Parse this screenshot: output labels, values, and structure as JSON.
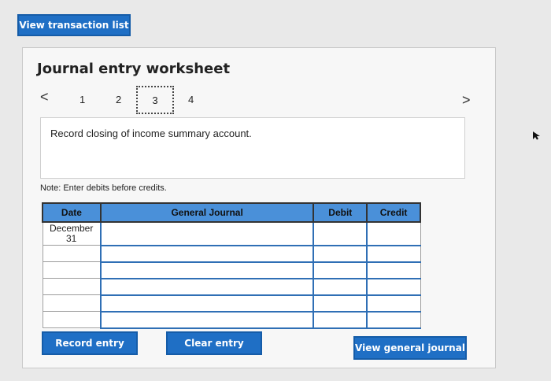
{
  "top_button": {
    "label": "View transaction list"
  },
  "worksheet": {
    "title": "Journal entry worksheet",
    "nav": {
      "prev_symbol": "<",
      "next_symbol": ">",
      "pages": [
        "1",
        "2",
        "3",
        "4"
      ],
      "active_page": "3"
    },
    "instruction": "Record closing of income summary account.",
    "note": "Note: Enter debits before credits."
  },
  "table": {
    "headers": {
      "date": "Date",
      "general_journal": "General Journal",
      "debit": "Debit",
      "credit": "Credit"
    },
    "first_row": {
      "date_month": "December",
      "date_day": "31"
    }
  },
  "buttons": {
    "record_entry": "Record entry",
    "clear_entry": "Clear entry",
    "view_general_journal": "View general journal"
  },
  "colors": {
    "accent": "#1f6fc5",
    "header_fill": "#4a90d9"
  }
}
